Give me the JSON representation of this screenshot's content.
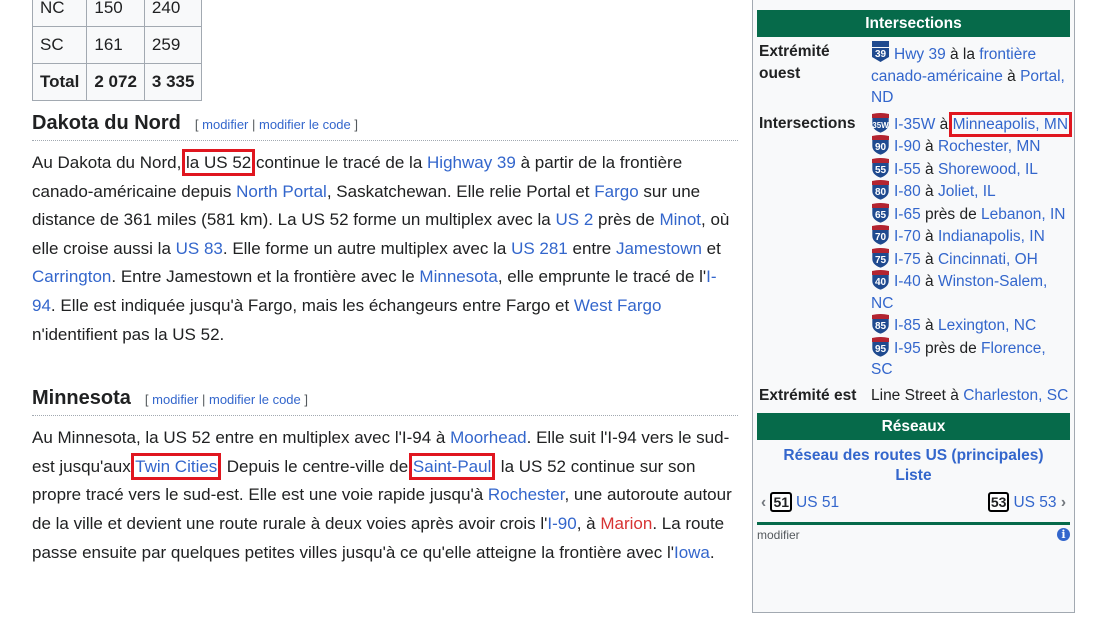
{
  "stats_table": {
    "rows": [
      {
        "state": "NC",
        "miles": "150",
        "km": "240"
      },
      {
        "state": "SC",
        "miles": "161",
        "km": "259"
      },
      {
        "state": "Total",
        "miles": "2 072",
        "km": "3 335"
      }
    ]
  },
  "sections": [
    {
      "title": "Dakota du Nord",
      "edit_open": "[ ",
      "edit": "modifier",
      "sep": " | ",
      "edit_code": "modifier le code",
      "edit_close": " ]",
      "paragraph": [
        {
          "t": "Au Dakota du Nord, "
        },
        {
          "t": "la US 52",
          "box": true
        },
        {
          "t": " continue le tracé de la "
        },
        {
          "t": "Highway 39",
          "link": true
        },
        {
          "t": " à partir de la frontière canado-américaine depuis "
        },
        {
          "t": "North Portal",
          "link": true
        },
        {
          "t": ", Saskatchewan. Elle relie Portal et "
        },
        {
          "t": "Fargo",
          "link": true
        },
        {
          "t": " sur une distance de 361 miles (581 km). La US 52 forme un multiplex avec la "
        },
        {
          "t": "US 2",
          "link": true
        },
        {
          "t": " près de "
        },
        {
          "t": "Minot",
          "link": true
        },
        {
          "t": ", où elle croise aussi la "
        },
        {
          "t": "US 83",
          "link": true
        },
        {
          "t": ". Elle forme un autre multiplex avec la "
        },
        {
          "t": "US 281",
          "link": true
        },
        {
          "t": " entre "
        },
        {
          "t": "Jamestown",
          "link": true
        },
        {
          "t": " et "
        },
        {
          "t": "Carrington",
          "link": true
        },
        {
          "t": ". Entre Jamestown et la frontière avec le "
        },
        {
          "t": "Minnesota",
          "link": true
        },
        {
          "t": ", elle emprunte le tracé de l'"
        },
        {
          "t": "I-94",
          "link": true
        },
        {
          "t": ". Elle est indiquée jusqu'à Fargo, mais les échangeurs entre Fargo et "
        },
        {
          "t": "West Fargo",
          "link": true
        },
        {
          "t": " n'identifient pas la US 52."
        }
      ]
    },
    {
      "title": "Minnesota",
      "edit_open": "[ ",
      "edit": "modifier",
      "sep": " | ",
      "edit_code": "modifier le code",
      "edit_close": " ]",
      "paragraph": [
        {
          "t": "Au Minnesota, la US 52 entre en multiplex avec l'I-94 à "
        },
        {
          "t": "Moorhead",
          "link": true
        },
        {
          "t": ". Elle suit l'I-94 vers le sud-est jusqu'aux "
        },
        {
          "t": "Twin Cities",
          "link": true,
          "box": true
        },
        {
          "t": ". Depuis le centre-ville de "
        },
        {
          "t": "Saint-Paul",
          "link": true,
          "box": true
        },
        {
          "t": ", la US 52 continue sur son propre tracé vers le sud-est. Elle est une voie rapide jusqu'à "
        },
        {
          "t": "Rochester",
          "link": true
        },
        {
          "t": ", une autoroute autour de la ville et devient une route rurale à deux voies après avoir crois l'"
        },
        {
          "t": "I-90",
          "link": true
        },
        {
          "t": ", à "
        },
        {
          "t": "Marion",
          "link": true,
          "red": true
        },
        {
          "t": ". La route passe ensuite par quelques petites villes jusqu'à ce qu'elle atteigne la frontière avec l'"
        },
        {
          "t": "Iowa",
          "link": true
        },
        {
          "t": "."
        }
      ]
    }
  ],
  "infobox": {
    "intersections_header": "Intersections",
    "west_label": "Extrémité ouest",
    "west": {
      "shield": "39",
      "road": "Hwy 39",
      "mid": " à la ",
      "place": "frontière canado-américaine",
      "mid2": " à ",
      "place2": "Portal, ND"
    },
    "intersections_label": "Intersections",
    "intersections": [
      {
        "shield": "35W",
        "road": "I-35W",
        "prep": " à ",
        "place": "Minneapolis, MN",
        "box": true
      },
      {
        "shield": "90",
        "road": "I-90",
        "prep": " à ",
        "place": "Rochester, MN"
      },
      {
        "shield": "55",
        "road": "I-55",
        "prep": " à ",
        "place": "Shorewood, IL"
      },
      {
        "shield": "80",
        "road": "I-80",
        "prep": " à ",
        "place": "Joliet, IL"
      },
      {
        "shield": "65",
        "road": "I-65",
        "prep": " près de ",
        "place": "Lebanon, IN"
      },
      {
        "shield": "70",
        "road": "I-70",
        "prep": " à ",
        "place": "Indianapolis, IN"
      },
      {
        "shield": "75",
        "road": "I-75",
        "prep": " à ",
        "place": "Cincinnati, OH"
      },
      {
        "shield": "40",
        "road": "I-40",
        "prep": " à ",
        "place": "Winston-Salem, NC"
      },
      {
        "shield": "85",
        "road": "I-85",
        "prep": " à ",
        "place": "Lexington, NC"
      },
      {
        "shield": "95",
        "road": "I-95",
        "prep": " près de ",
        "place": "Florence, SC"
      }
    ],
    "east_label": "Extrémité est",
    "east": {
      "text": "Line Street à ",
      "place": "Charleston, SC"
    },
    "networks_header": "Réseaux",
    "network_link": "Réseau des routes US (principales)",
    "list_link": "Liste",
    "prev": {
      "shield": "51",
      "label": "US 51"
    },
    "next": {
      "shield": "53",
      "label": "US 53"
    },
    "footer_edit": "modifier",
    "info_icon": "i",
    "colors": {
      "header": "#066a4a",
      "link": "#3366cc",
      "redlink": "#d73333",
      "highlight": "#e0161f"
    }
  }
}
